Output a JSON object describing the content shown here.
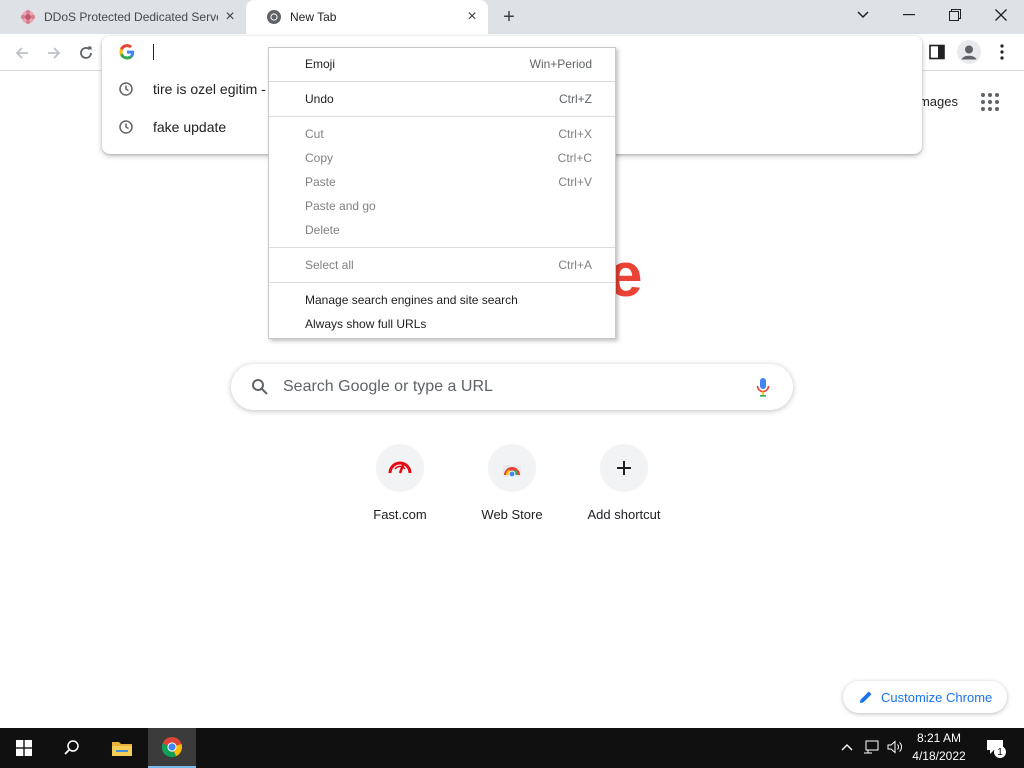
{
  "tabs": [
    {
      "title": "DDoS Protected Dedicated Serve",
      "active": false
    },
    {
      "title": "New Tab",
      "active": true
    }
  ],
  "omnibox": {
    "value": "",
    "suggestions": [
      {
        "text": "tire is ozel egitim -"
      },
      {
        "text": "fake update"
      }
    ]
  },
  "page": {
    "images_link": "Images",
    "logo_fragment": "e",
    "search_placeholder": "Search Google or type a URL",
    "shortcuts": [
      {
        "label": "Fast.com"
      },
      {
        "label": "Web Store"
      },
      {
        "label": "Add shortcut"
      }
    ],
    "customize_label": "Customize Chrome"
  },
  "context_menu": {
    "items": [
      {
        "label": "Emoji",
        "shortcut": "Win+Period",
        "enabled": true
      },
      {
        "label": "Undo",
        "shortcut": "Ctrl+Z",
        "enabled": true
      },
      {
        "label": "Cut",
        "shortcut": "Ctrl+X",
        "enabled": false
      },
      {
        "label": "Copy",
        "shortcut": "Ctrl+C",
        "enabled": false
      },
      {
        "label": "Paste",
        "shortcut": "Ctrl+V",
        "enabled": false
      },
      {
        "label": "Paste and go",
        "shortcut": "",
        "enabled": false
      },
      {
        "label": "Delete",
        "shortcut": "",
        "enabled": false
      },
      {
        "label": "Select all",
        "shortcut": "Ctrl+A",
        "enabled": false
      },
      {
        "label": "Manage search engines and site search",
        "shortcut": "",
        "enabled": true
      },
      {
        "label": "Always show full URLs",
        "shortcut": "",
        "enabled": true
      }
    ]
  },
  "taskbar": {
    "time": "8:21 AM",
    "date": "4/18/2022",
    "notification_count": "1"
  },
  "colors": {
    "tabstrip_bg": "#dee1e6",
    "accent_blue": "#1a73e8",
    "logo_red": "#ea4335",
    "taskbar_bg": "#101010"
  }
}
